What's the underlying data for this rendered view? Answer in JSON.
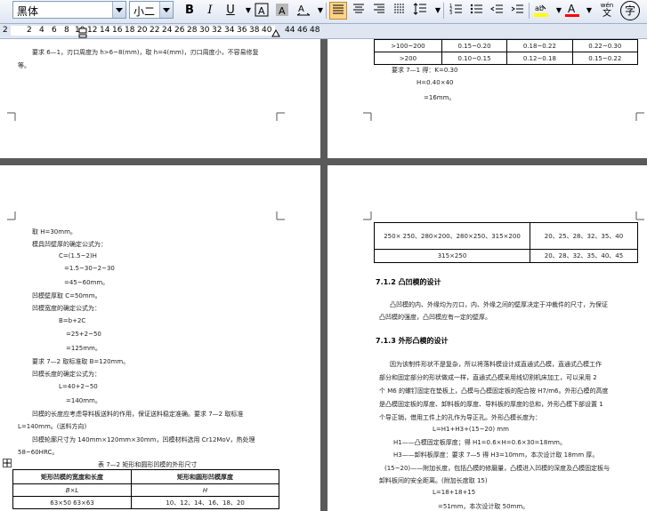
{
  "toolbar": {
    "font_name": "黑体",
    "font_size": "小二",
    "bold": "B",
    "italic": "I",
    "underline": "U",
    "wen_label": "wén",
    "zi_label": "字"
  },
  "ruler": {
    "marks": [
      "2",
      "2",
      "4",
      "6",
      "8",
      "10",
      "12",
      "14",
      "16",
      "18",
      "20",
      "22",
      "24",
      "26",
      "28",
      "30",
      "32",
      "34",
      "36",
      "38",
      "40",
      "44",
      "46",
      "48"
    ]
  },
  "top_left_page": {
    "line1": "要求 6—1，刃口周度为 h>6~8(mm)，取 h=4(mm)，刃口周度小，不容易修复",
    "line2": "等。"
  },
  "top_right_page": {
    "table_rows": [
      [
        ">100~200",
        "0.15~0.20",
        "0.18~0.22",
        "0.22~0.30"
      ],
      [
        ">200",
        "0.10~0.15",
        "0.12~0.18",
        "0.15~0.22"
      ]
    ],
    "line1": "要求 7—1 得：K=0.30",
    "line2": "H=0.40×40",
    "line3": "=16mm。"
  },
  "bottom_left_page": {
    "lines": [
      "取 H=30mm。",
      "模具凹壁厚的确定公式为：",
      "C=(1.5~2)H",
      "=1.5~30~2~30",
      "=45~60mm。",
      "凹模壁厚取 C=50mm。",
      "凹模宽度的确定公式为：",
      "B=b+2C",
      "=25+2~50",
      "=125mm。",
      "要求 7—2 取标准取 B=120mm。",
      "凹模长度的确定公式为：",
      "L=40+2~50",
      "=140mm。",
      "凹模的长度应考虑导料板送料的作用，保证送料稳定准确。要求 7—2 取标准",
      "L=140mm。(送料方向)",
      "凹模轮廓尺寸为 140mm×120mm×30mm，凹模材料选用 Cr12MoV，热处理",
      "58~60HRC。"
    ],
    "table_caption": "表 7—2  矩形和圆形凹模的外形尺寸",
    "table_headers": [
      "矩形凹模的宽度和长度",
      "矩形和圆形凹模厚度"
    ],
    "table_subheaders": [
      "B×L",
      "H"
    ],
    "table_row": [
      "63×50    63×63",
      "10、12、14、16、18、20"
    ]
  },
  "bottom_right_page": {
    "table_rows": [
      [
        "250× 250、280×200、280×250、315×200",
        "20、25、28、32、35、40"
      ],
      [
        "315×250",
        "20、28、32、35、40、45"
      ]
    ],
    "section1_title": "7.1.2 凸凹模的设计",
    "section1_text": [
      "凸凹模的内、外缘均为刃口，内、外缘之间的壁厚决定于冲裁件的尺寸，为保证",
      "凸凹模的强度，凸凹模应有一定的壁厚。"
    ],
    "section2_title": "7.1.3 外形凸模的设计",
    "section2_text": [
      "因为该制件形状不是复杂，所以将落料模设计成直通式凸模，直通式凸模工作",
      "部分和固定部分的形状做成一样，直通式凸模采用线切割机床加工，可以采用 2",
      "个 M6 的螺钉固定在垫板上，凸模与凸模固定板的配合按 H7/m6。外形凸模的高度",
      "是凸模固定板的厚度、卸料板的厚度、导料板的厚度的总和，外形凸模下部设置 1",
      "个导正销，借用工件上的孔作为导正孔。外形凸模长度为：",
      "L=H1+H3+(15~20) mm",
      "H1——凸模固定板厚度；得 H1=0.6×H=0.6×30=18mm。",
      "H3——卸料板厚度：要求 7—5 得 H3=10mm，本次设计取 18mm 厚。",
      "(15~20)——附加长度，包括凸模的修磨量，凸模进入凹模的深度及凸模固定板与",
      "卸料板间的安全距离。(附加长度取 15)",
      "L=18+18+15",
      "=51mm，本次设计取 50mm。"
    ]
  }
}
